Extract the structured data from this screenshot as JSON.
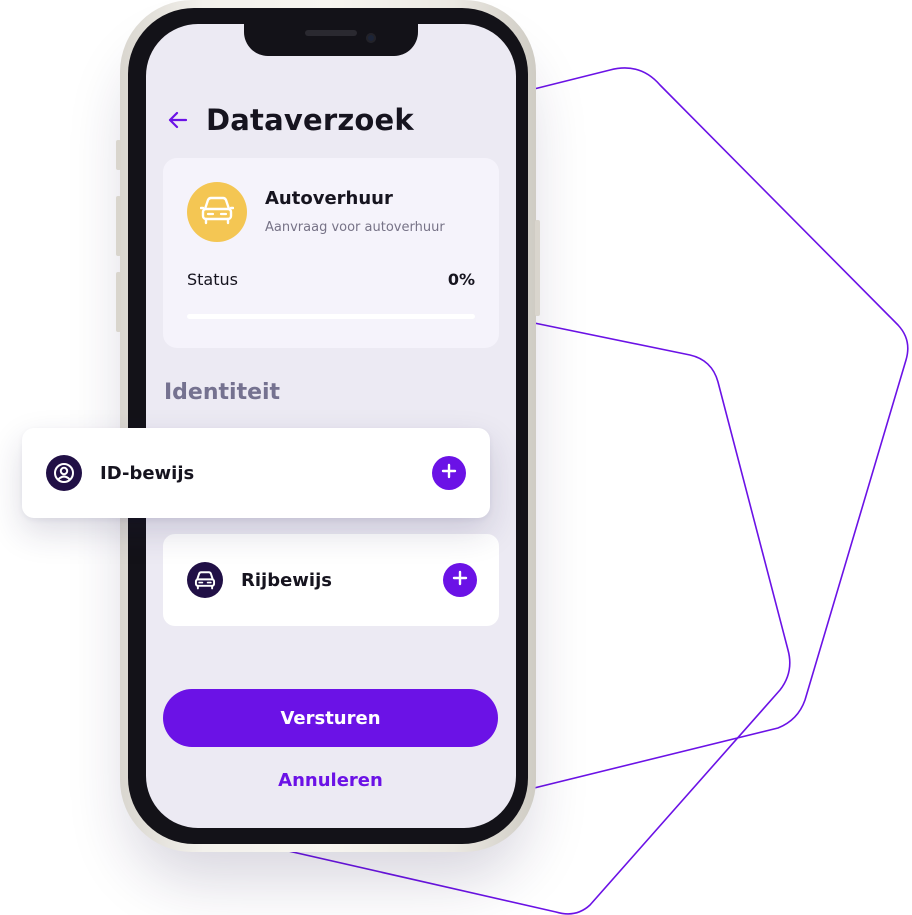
{
  "colors": {
    "accent": "#6b12e6",
    "car_badge": "#f4c653",
    "icon_dark": "#211046",
    "screen_bg": "#eceaf3",
    "card_bg": "#f5f3fb",
    "heading_muted": "#757290"
  },
  "header": {
    "back_icon": "arrow-left-icon",
    "title": "Dataverzoek"
  },
  "request": {
    "icon": "car-icon",
    "title": "Autoverhuur",
    "subtitle": "Aanvraag voor autoverhuur",
    "status_label": "Status",
    "status_value": "0%",
    "progress_fraction": 0
  },
  "section": {
    "heading": "Identiteit"
  },
  "documents": [
    {
      "label": "ID-bewijs",
      "icon": "user-circle-icon",
      "action_icon": "plus-icon"
    },
    {
      "label": "Rijbewijs",
      "icon": "car-icon",
      "action_icon": "plus-icon"
    }
  ],
  "actions": {
    "submit_label": "Versturen",
    "cancel_label": "Annuleren"
  }
}
